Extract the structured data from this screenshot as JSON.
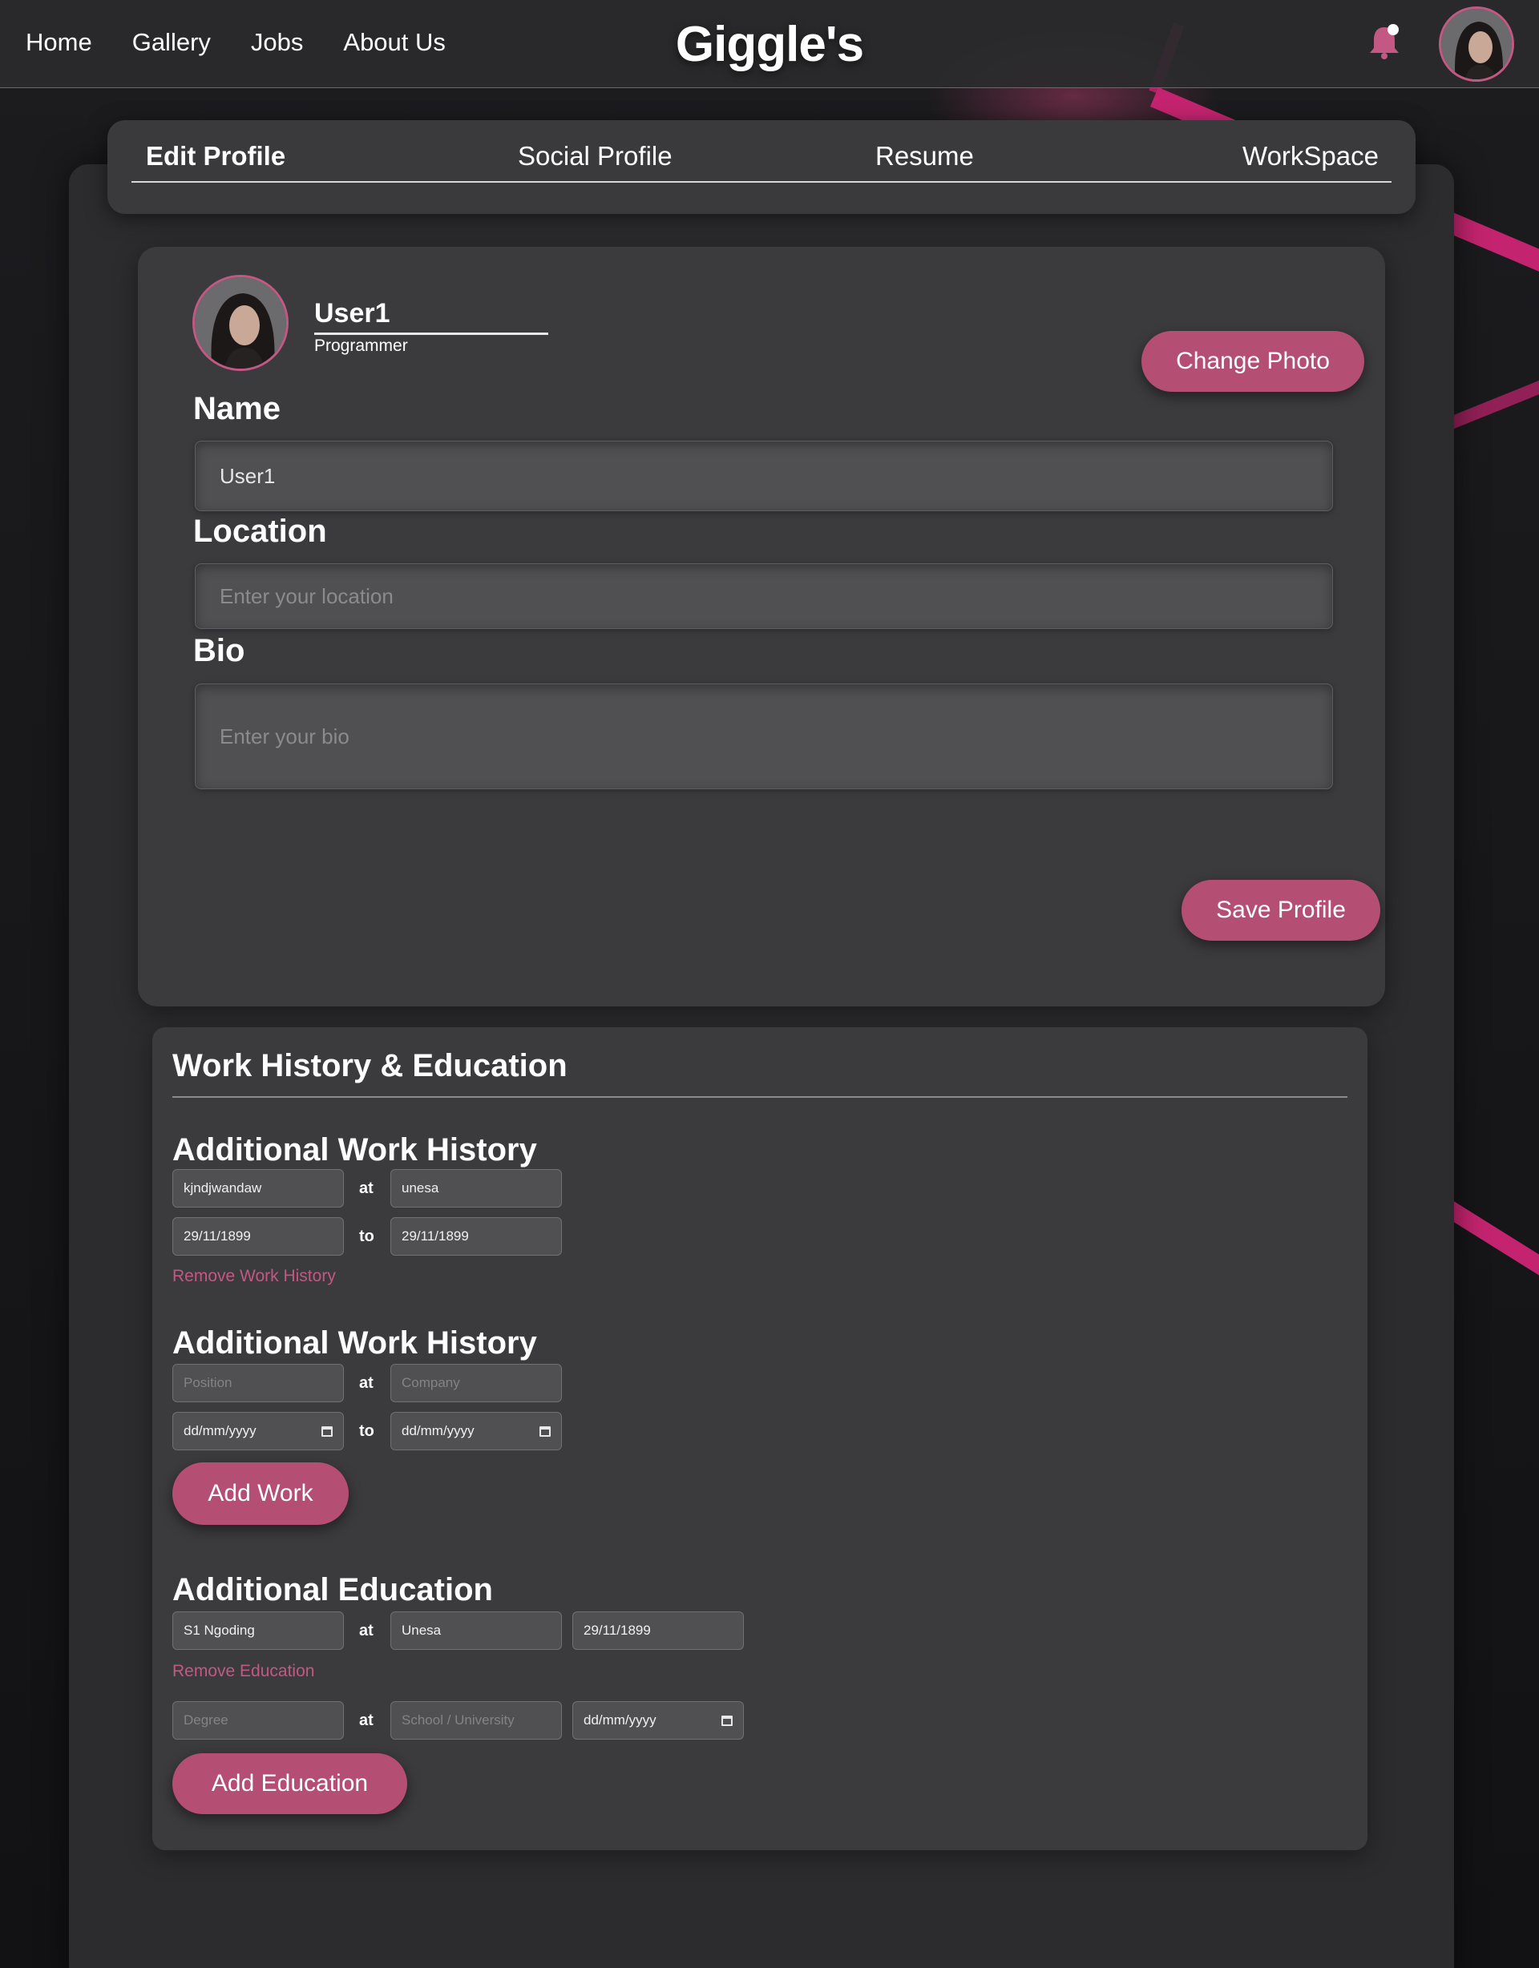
{
  "nav": {
    "items": [
      "Home",
      "Gallery",
      "Jobs",
      "About Us"
    ],
    "brand": "Giggle's"
  },
  "icons": {
    "notifications": "bell-icon",
    "avatar": "user-avatar"
  },
  "colors": {
    "accent": "#b44e72",
    "accent_text": "#c25883",
    "panel": "#3b3b3e",
    "input": "#505053"
  },
  "tabs": [
    "Edit Profile",
    "Social Profile",
    "Resume",
    "WorkSpace"
  ],
  "profile": {
    "username": "User1",
    "role": "Programmer",
    "change_photo": "Change Photo",
    "name_label": "Name",
    "name_value": "User1",
    "location_label": "Location",
    "location_placeholder": "Enter your location",
    "bio_label": "Bio",
    "bio_placeholder": "Enter your bio",
    "save": "Save Profile"
  },
  "history": {
    "title": "Work History & Education",
    "work_title": "Additional Work History",
    "at": "at",
    "to": "to",
    "work_entry": {
      "position": "kjndjwandaw",
      "company": "unesa",
      "start": "29/11/1899",
      "end": "29/11/1899"
    },
    "remove_work": "Remove Work History",
    "new_work": {
      "position_placeholder": "Position",
      "company_placeholder": "Company",
      "start_placeholder": "dd/mm/yyyy",
      "end_placeholder": "dd/mm/yyyy"
    },
    "add_work": "Add Work",
    "edu_title": "Additional Education",
    "edu_entry": {
      "degree": "S1 Ngoding",
      "school": "Unesa",
      "date": "29/11/1899"
    },
    "remove_edu": "Remove Education",
    "new_edu": {
      "degree_placeholder": "Degree",
      "school_placeholder": "School / University",
      "date_placeholder": "dd/mm/yyyy"
    },
    "add_edu": "Add Education"
  }
}
